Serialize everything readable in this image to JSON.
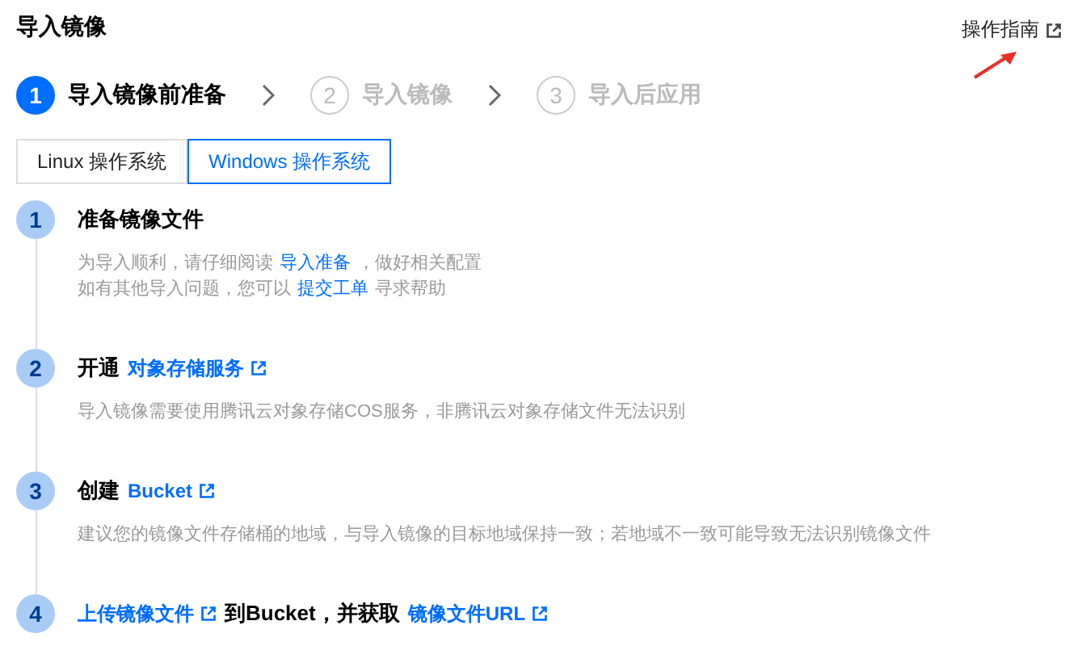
{
  "header": {
    "title": "导入镜像",
    "guide_link": "操作指南"
  },
  "steps": [
    {
      "number": "1",
      "label": "导入镜像前准备",
      "selected": true
    },
    {
      "number": "2",
      "label": "导入镜像",
      "selected": false
    },
    {
      "number": "3",
      "label": "导入后应用",
      "selected": false
    }
  ],
  "os_tabs": [
    {
      "label": "Linux 操作系统",
      "selected": false
    },
    {
      "label": "Windows 操作系统",
      "selected": true
    }
  ],
  "timeline": [
    {
      "number": "1",
      "title": [
        {
          "kind": "text",
          "text": "准备镜像文件"
        }
      ],
      "description": [
        [
          {
            "kind": "text",
            "text": "为导入顺利，请仔细阅读"
          },
          {
            "kind": "link",
            "text": "导入准备"
          },
          {
            "kind": "text",
            "text": "，做好相关配置"
          }
        ],
        [
          {
            "kind": "text",
            "text": "如有其他导入问题，您可以"
          },
          {
            "kind": "link",
            "text": "提交工单"
          },
          {
            "kind": "text",
            "text": "寻求帮助"
          }
        ]
      ]
    },
    {
      "number": "2",
      "title": [
        {
          "kind": "text",
          "text": "开通"
        },
        {
          "kind": "external",
          "text": "对象存储服务"
        }
      ],
      "description": [
        [
          {
            "kind": "text",
            "text": "导入镜像需要使用腾讯云对象存储COS服务，非腾讯云对象存储文件无法识别"
          }
        ]
      ]
    },
    {
      "number": "3",
      "title": [
        {
          "kind": "text",
          "text": "创建"
        },
        {
          "kind": "external",
          "text": "Bucket"
        }
      ],
      "description": [
        [
          {
            "kind": "text",
            "text": "建议您的镜像文件存储桶的地域，与导入镜像的目标地域保持一致；若地域不一致可能导致无法识别镜像文件"
          }
        ]
      ]
    },
    {
      "number": "4",
      "title": [
        {
          "kind": "external",
          "text": "上传镜像文件"
        },
        {
          "kind": "text",
          "text": "到Bucket，并获取"
        },
        {
          "kind": "external",
          "text": "镜像文件URL"
        }
      ]
    }
  ]
}
